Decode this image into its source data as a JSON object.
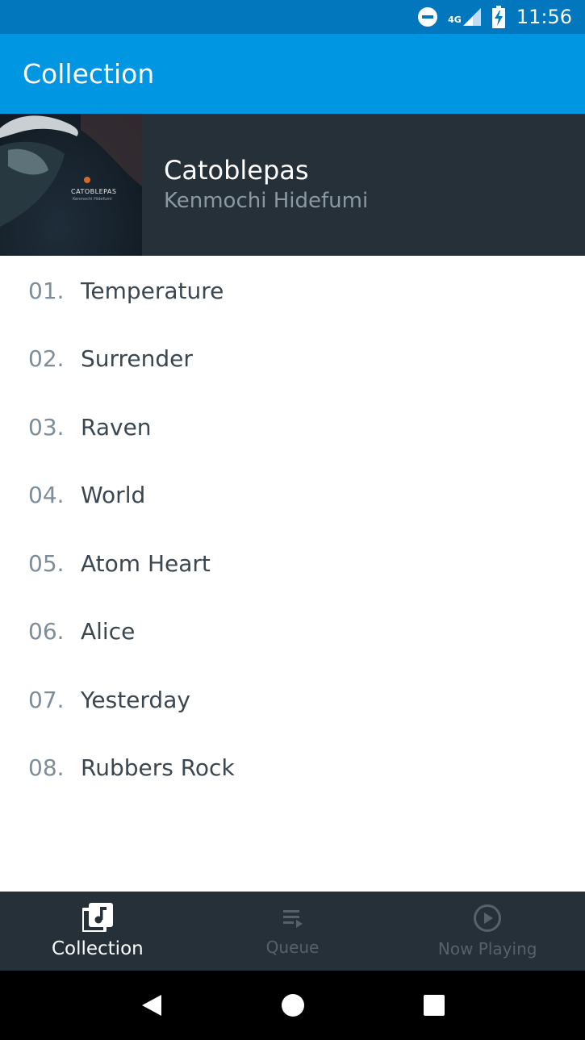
{
  "status_bar": {
    "time": "11:56",
    "network_label": "4G",
    "icons": [
      "do-not-disturb-icon",
      "signal-icon",
      "battery-charging-icon"
    ]
  },
  "app_bar": {
    "title": "Collection"
  },
  "album": {
    "title": "Catoblepas",
    "artist": "Kenmochi Hidefumi",
    "art_text": "CATOBLEPAS",
    "art_subtext": "Kenmochi Hidefumi"
  },
  "tracks": [
    {
      "number": "01.",
      "name": "Temperature"
    },
    {
      "number": "02.",
      "name": "Surrender"
    },
    {
      "number": "03.",
      "name": "Raven"
    },
    {
      "number": "04.",
      "name": "World"
    },
    {
      "number": "05.",
      "name": "Atom Heart"
    },
    {
      "number": "06.",
      "name": "Alice"
    },
    {
      "number": "07.",
      "name": "Yesterday"
    },
    {
      "number": "08.",
      "name": "Rubbers Rock"
    }
  ],
  "bottom_nav": {
    "items": [
      {
        "label": "Collection",
        "icon": "library-music-icon",
        "active": true
      },
      {
        "label": "Queue",
        "icon": "queue-icon",
        "active": false
      },
      {
        "label": "Now Playing",
        "icon": "play-circle-icon",
        "active": false
      }
    ]
  },
  "colors": {
    "status_bar": "#0277bd",
    "app_bar": "#0096e2",
    "header_bg": "#263038",
    "track_number": "#7d8d99",
    "track_name": "#3a4650"
  }
}
